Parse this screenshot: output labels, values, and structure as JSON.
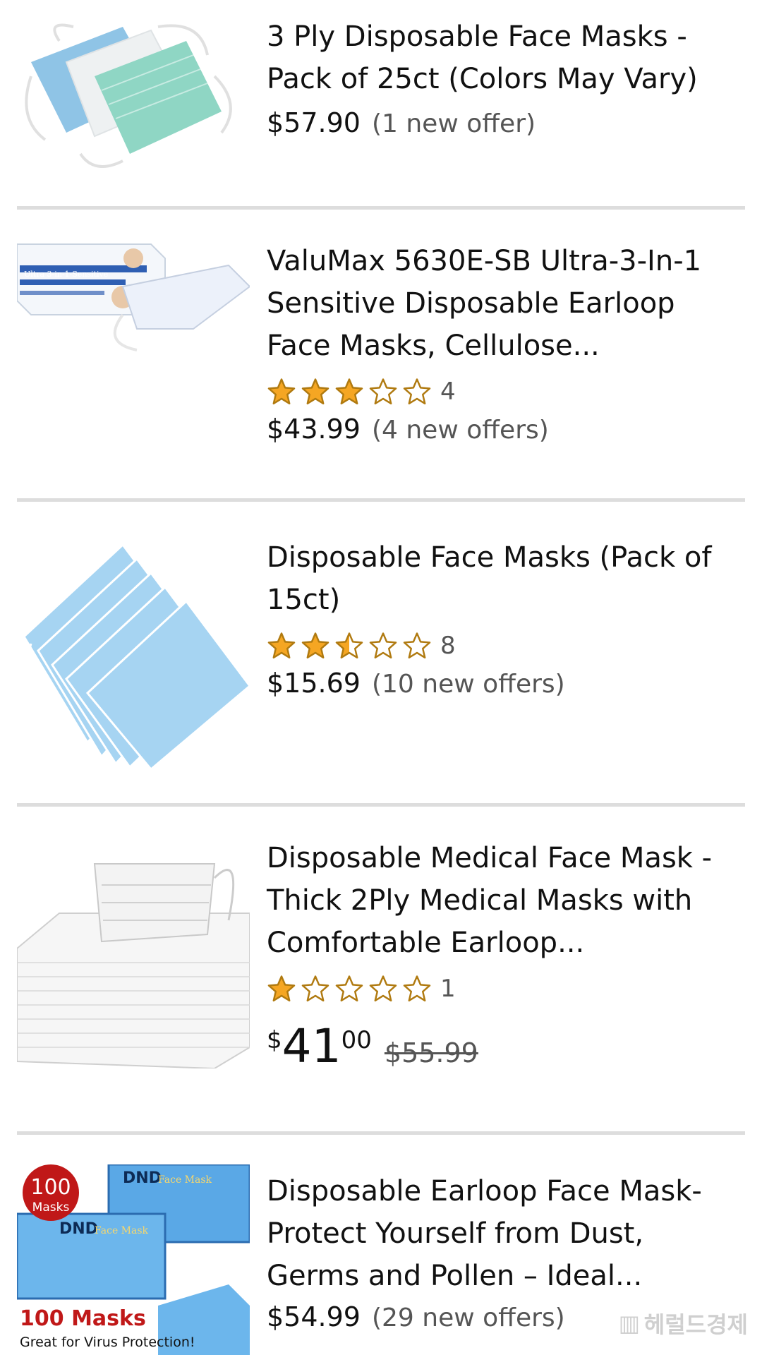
{
  "products": [
    {
      "title": "3 Ply Disposable Face Masks - Pack of 25ct (Colors May Vary)",
      "price": "$57.90",
      "offers": "(1 new offer)"
    },
    {
      "title": "ValuMax 5630E-SB Ultra-3-In-1 Sensitive Disposable Earloop Face Masks, Cellulose...",
      "rating": 3,
      "rating_count": "4",
      "price": "$43.99",
      "offers": "(4 new offers)",
      "image_text": "Ultra 3-in-1-Sensitive"
    },
    {
      "title": "Disposable Face Masks (Pack of 15ct)",
      "rating": 2.5,
      "rating_count": "8",
      "price": "$15.69",
      "offers": "(10 new offers)"
    },
    {
      "title": "Disposable Medical Face Mask - Thick 2Ply Medical Masks with Comfortable Earloop...",
      "rating": 1,
      "rating_count": "1",
      "price_currency": "$",
      "price_whole": "41",
      "price_fraction": "00",
      "list_price": "$55.99"
    },
    {
      "title": "Disposable Earloop Face Mask- Protect Yourself from Dust, Germs and Pollen – Ideal...",
      "price": "$54.99",
      "offers": "(29 new offers)",
      "badge_count": "100",
      "badge_label": "Masks",
      "box_brand": "DND",
      "box_text": "Face Mask",
      "image_caption": "100 Masks",
      "image_caption_sub": "Great for Virus Protection!"
    }
  ],
  "watermark": "헤럴드경제",
  "colors": {
    "star_fill": "#F5A623",
    "star_stroke": "#B07A10",
    "divider": "#DDDDDD"
  }
}
